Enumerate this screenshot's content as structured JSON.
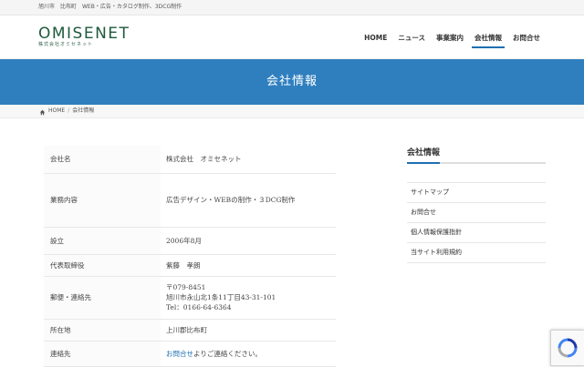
{
  "topbar": {
    "text": "旭川市　比布町　WEB・広告・カタログ制作、3DCG制作"
  },
  "logo": {
    "main": "OMISENET",
    "sub": "株式会社オミセネット"
  },
  "nav": [
    {
      "label": "HOME"
    },
    {
      "label": "ニュース"
    },
    {
      "label": "事業案内"
    },
    {
      "label": "会社情報"
    },
    {
      "label": "お問合せ"
    }
  ],
  "banner": {
    "title": "会社情報"
  },
  "breadcrumb": {
    "home": "HOME",
    "separator": "/",
    "current": "会社情報"
  },
  "info": {
    "rows": [
      {
        "key": "会社名",
        "value": "株式会社　オミセネット"
      },
      {
        "key": "業務内容",
        "value": "広告デザイン・WEBの制作・３DCG制作"
      },
      {
        "key": "設立",
        "value": "2006年8月"
      },
      {
        "key": "代表取締役",
        "value": "紫藤　孝朗"
      },
      {
        "key": "郵便・連絡先",
        "lines": [
          "〒079-8451",
          "旭川市永山北1条11丁目43-31-101",
          "Tel：0166-64-6364"
        ]
      },
      {
        "key": "所在地",
        "value": "上川郡比布町"
      },
      {
        "key": "連絡先",
        "link": "お問合せ",
        "suffix": "よりご連絡ください。"
      }
    ]
  },
  "sidebar": {
    "title": "会社情報",
    "items": [
      {
        "label": "サイトマップ"
      },
      {
        "label": "お問合せ"
      },
      {
        "label": "個人情報保護指針"
      },
      {
        "label": "当サイト利用規約"
      }
    ]
  },
  "colors": {
    "accent": "#2f7fbf",
    "logo": "#1e5a3c",
    "link": "#1e6fb0"
  },
  "icons": {
    "breadcrumb_home": "home-icon",
    "recaptcha": "recaptcha-icon"
  }
}
